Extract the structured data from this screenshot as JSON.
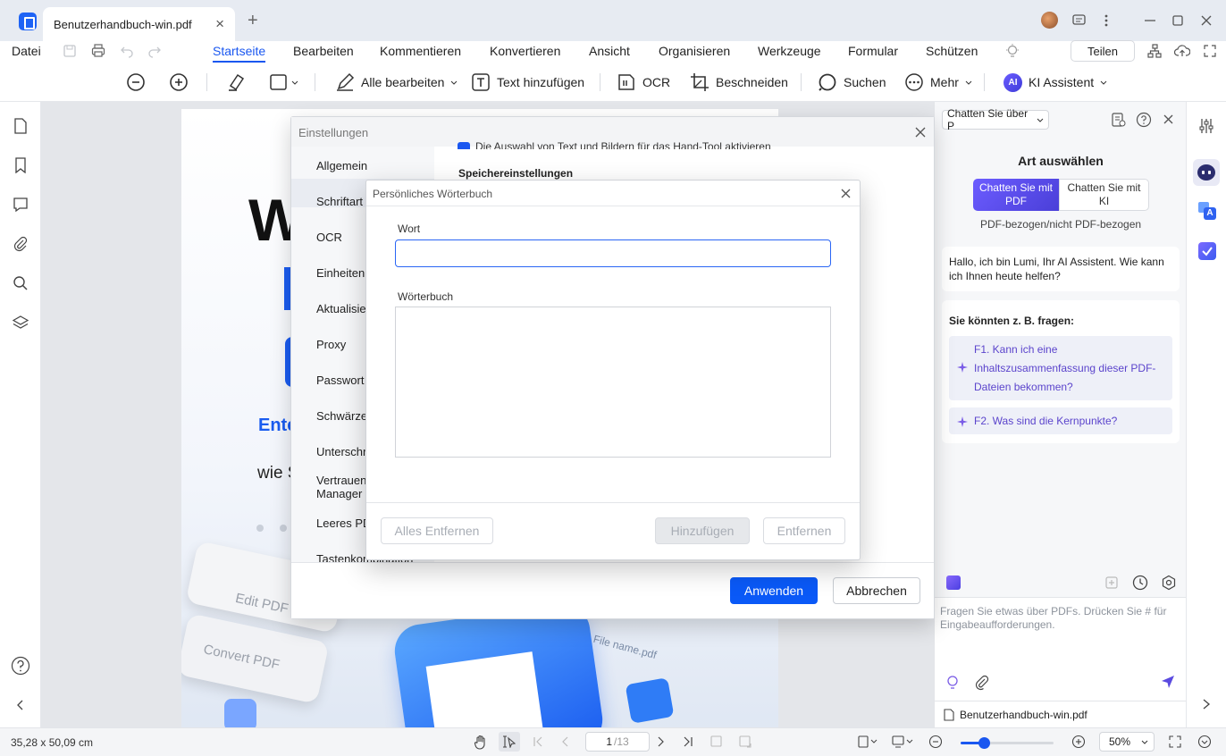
{
  "titlebar": {
    "tab_title": "Benutzerhandbuch-win.pdf",
    "close_symbol": "×",
    "new_tab_symbol": "+"
  },
  "menubar": {
    "file": "Datei",
    "items": [
      "Startseite",
      "Bearbeiten",
      "Kommentieren",
      "Konvertieren",
      "Ansicht",
      "Organisieren",
      "Werkzeuge",
      "Formular",
      "Schützen"
    ],
    "active": "Startseite",
    "share": "Teilen"
  },
  "toolbar": {
    "edit_all": "Alle bearbeiten",
    "add_text": "Text hinzufügen",
    "ocr": "OCR",
    "crop": "Beschneiden",
    "search": "Suchen",
    "more": "Mehr",
    "ai_assistant": "KI Assistent",
    "ai_badge": "AI"
  },
  "page_preview": {
    "big_letter": "W",
    "blue_text": "Ente",
    "gray_text": "wie S",
    "key_edit": "Edit PDF",
    "key_convert": "Convert PDF",
    "filename_label": "File name.pdf"
  },
  "settings": {
    "title": "Einstellungen",
    "nav": [
      "Allgemein",
      "Schriftart",
      "OCR",
      "Einheiten & ",
      "Aktualisier",
      "Proxy",
      "Passwort",
      "Schwärzen",
      "Unterschre",
      "Vertrauens Manager",
      "Leeres PDF",
      "Tastenkombination"
    ],
    "nav_active": "Allgemein",
    "checkbox_text": "Die Auswahl von Text und Bildern für das Hand-Tool aktivieren",
    "storage_heading": "Speichereinstellungen",
    "apply": "Anwenden",
    "cancel": "Abbrechen"
  },
  "dictionary": {
    "title": "Persönliches Wörterbuch",
    "word_label": "Wort",
    "word_value": "",
    "dictionary_label": "Wörterbuch",
    "remove_all": "Alles Entfernen",
    "add": "Hinzufügen",
    "remove": "Entfernen"
  },
  "ai_panel": {
    "mode_dropdown": "Chatten Sie über P",
    "select_type": "Art auswählen",
    "mode_pdf": "Chatten Sie mit PDF",
    "mode_ai": "Chatten Sie mit KI",
    "mode_caption": "PDF-bezogen/nicht PDF-bezogen",
    "greeting": "Hallo, ich bin Lumi, Ihr AI Assistent. Wie kann ich Ihnen heute helfen?",
    "suggest_heading": "Sie könnten z. B. fragen:",
    "q1": "F1. Kann ich eine Inhaltszusammenfassung dieser PDF-Dateien bekommen?",
    "q2": "F2. Was sind die Kernpunkte?",
    "input_placeholder": "Fragen Sie etwas über PDFs. Drücken Sie # für Eingabeaufforderungen.",
    "file_name": "Benutzerhandbuch-win.pdf"
  },
  "statusbar": {
    "page_size": "35,28 x 50,09 cm",
    "page_current": "1",
    "page_total": "/13",
    "zoom": "50%",
    "zoom_fraction": 0.5
  },
  "colors": {
    "accent": "#0a59f7",
    "ai_purple": "#5b4be0",
    "suggest_text": "#6b4fd6"
  }
}
